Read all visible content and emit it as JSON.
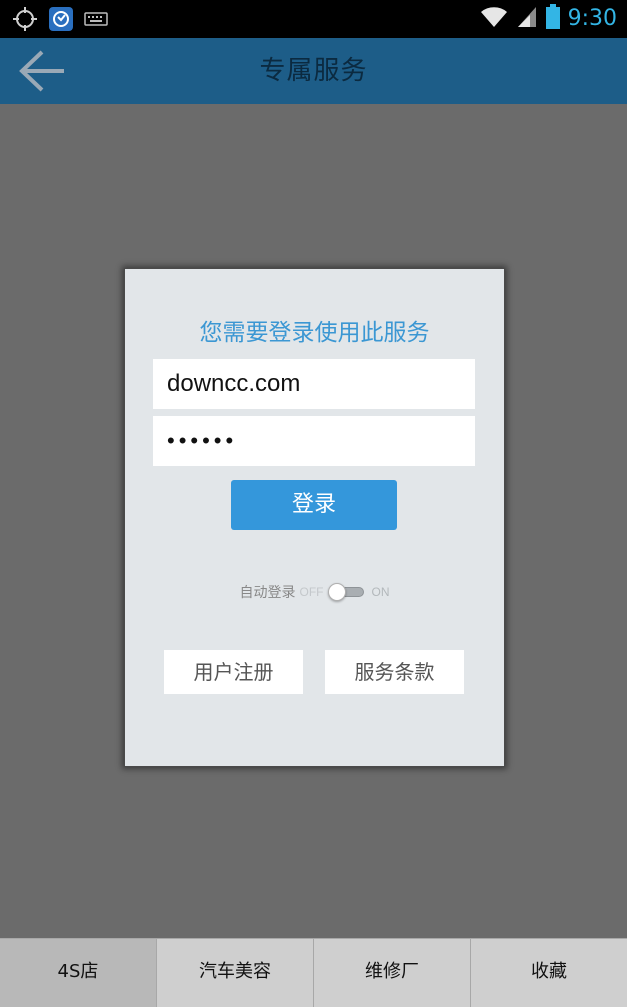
{
  "status_bar": {
    "time": "9:30",
    "icons": [
      "gps-icon",
      "app-notification-icon",
      "keyboard-icon",
      "wifi-icon",
      "signal-icon",
      "battery-icon"
    ]
  },
  "header": {
    "title": "专属服务",
    "back_icon": "back-arrow-icon"
  },
  "dialog": {
    "title": "您需要登录使用此服务",
    "username_value": "downcc.com",
    "password_value": "••••••",
    "login_label": "登录",
    "auto_login_label": "自动登录",
    "toggle_off": "OFF",
    "toggle_on": "ON",
    "auto_login_enabled": false,
    "register_label": "用户注册",
    "terms_label": "服务条款"
  },
  "tabs": [
    {
      "label": "4S店",
      "active": true
    },
    {
      "label": "汽车美容",
      "active": false
    },
    {
      "label": "维修厂",
      "active": false
    },
    {
      "label": "收藏",
      "active": false
    }
  ],
  "colors": {
    "status_accent": "#33b5e5",
    "header_bg": "#1d5d88",
    "dialog_title": "#3b97d3",
    "login_button": "#3497db",
    "overlay": "#6b6b6b"
  }
}
